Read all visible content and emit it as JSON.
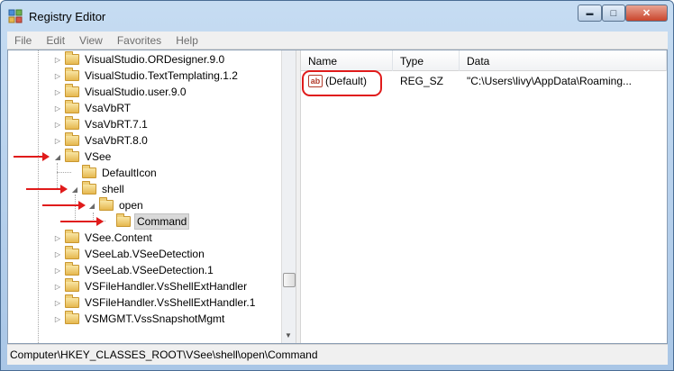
{
  "window": {
    "title": "Registry Editor",
    "icon": "registry-editor-icon",
    "controls": {
      "minimize": "▬",
      "maximize": "□",
      "close": "✕"
    }
  },
  "menu": [
    "File",
    "Edit",
    "View",
    "Favorites",
    "Help"
  ],
  "tree": {
    "items": [
      {
        "label": "VisualStudio.ORDesigner.9.0",
        "expander": "▷"
      },
      {
        "label": "VisualStudio.TextTemplating.1.2",
        "expander": "▷"
      },
      {
        "label": "VisualStudio.user.9.0",
        "expander": "▷"
      },
      {
        "label": "VsaVbRT",
        "expander": "▷"
      },
      {
        "label": "VsaVbRT.7.1",
        "expander": "▷"
      },
      {
        "label": "VsaVbRT.8.0",
        "expander": "▷"
      },
      {
        "label": "VSee",
        "expander": "◢"
      },
      {
        "label": "DefaultIcon",
        "expander": ""
      },
      {
        "label": "shell",
        "expander": "◢"
      },
      {
        "label": "open",
        "expander": "◢"
      },
      {
        "label": "Command",
        "expander": "",
        "selected": true
      },
      {
        "label": "VSee.Content",
        "expander": "▷"
      },
      {
        "label": "VSeeLab.VSeeDetection",
        "expander": "▷"
      },
      {
        "label": "VSeeLab.VSeeDetection.1",
        "expander": "▷"
      },
      {
        "label": "VSFileHandler.VsShellExtHandler",
        "expander": "▷"
      },
      {
        "label": "VSFileHandler.VsShellExtHandler.1",
        "expander": "▷"
      },
      {
        "label": "VSMGMT.VssSnapshotMgmt",
        "expander": "▷"
      }
    ]
  },
  "list": {
    "columns": {
      "name": "Name",
      "type": "Type",
      "data": "Data"
    },
    "rows": [
      {
        "icon": "ab",
        "name": "(Default)",
        "type": "REG_SZ",
        "data": "\"C:\\Users\\livy\\AppData\\Roaming..."
      }
    ]
  },
  "status": {
    "path": "Computer\\HKEY_CLASSES_ROOT\\VSee\\shell\\open\\Command"
  },
  "colors": {
    "annotation": "#e01b1b",
    "folder": "#e6b84f"
  }
}
